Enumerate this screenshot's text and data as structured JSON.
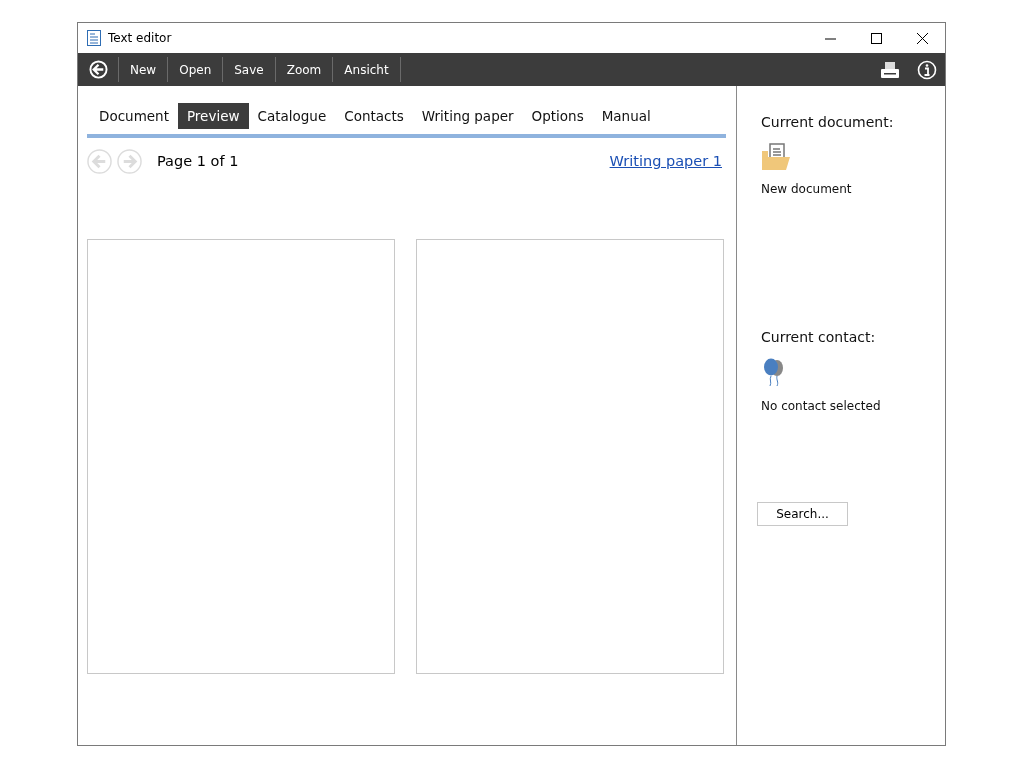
{
  "window": {
    "title": "Text editor"
  },
  "toolbar": {
    "items": [
      "New",
      "Open",
      "Save",
      "Zoom",
      "Ansicht"
    ]
  },
  "tabs": [
    {
      "label": "Document",
      "selected": false
    },
    {
      "label": "Preview",
      "selected": true
    },
    {
      "label": "Catalogue",
      "selected": false
    },
    {
      "label": "Contacts",
      "selected": false
    },
    {
      "label": "Writing paper",
      "selected": false
    },
    {
      "label": "Options",
      "selected": false
    },
    {
      "label": "Manual",
      "selected": false
    }
  ],
  "navigation": {
    "back_disabled": true,
    "forward_disabled": true,
    "page": "Page 1 of 1",
    "link": "Writing paper 1"
  },
  "sidebar": {
    "document_heading": "Current document:",
    "document_name": "New document",
    "contact_heading": "Current contact:",
    "contact_name": "No contact selected",
    "search_button": "Search..."
  }
}
